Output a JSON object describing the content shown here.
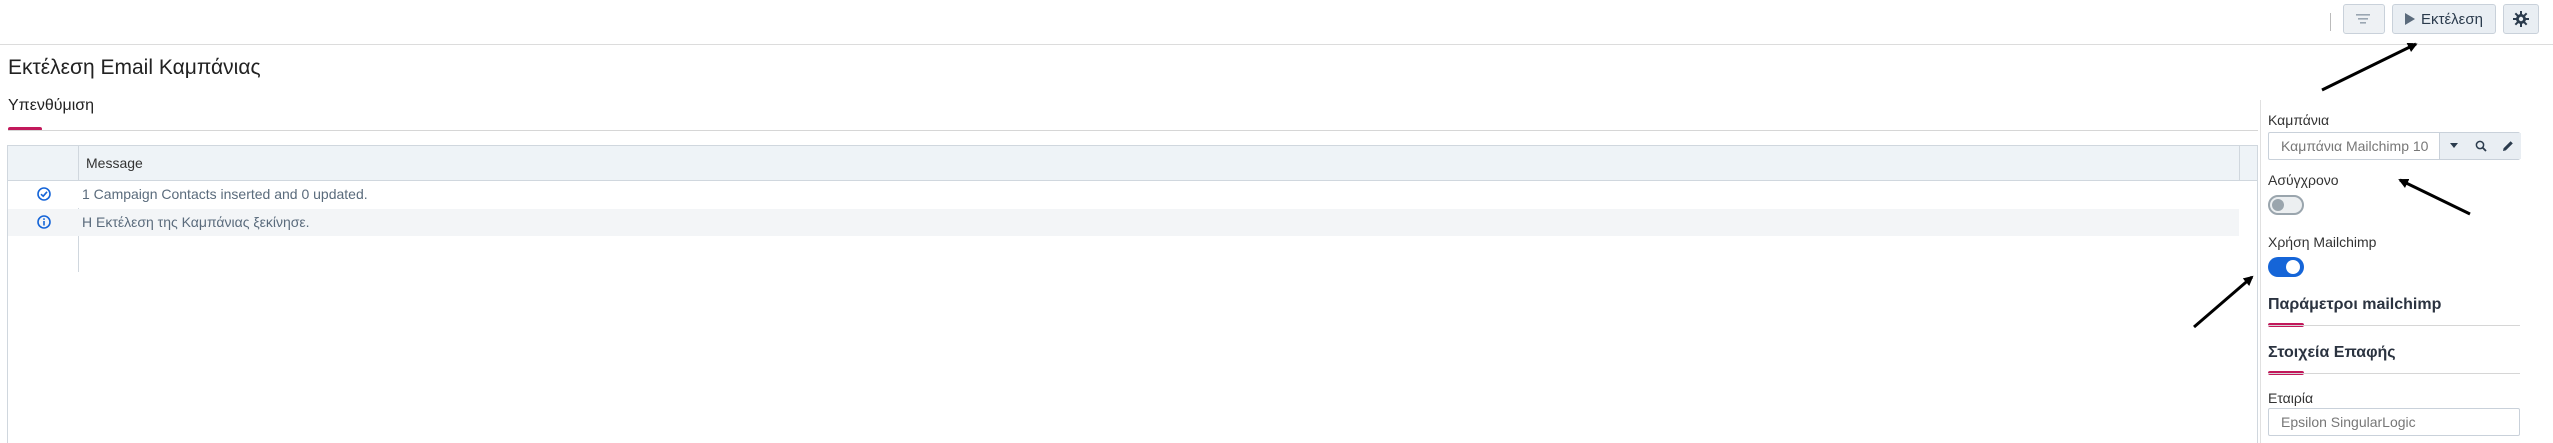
{
  "toolbar": {
    "run_label": "Εκτέλεση"
  },
  "page": {
    "title": "Εκτέλεση Email Καμπάνιας"
  },
  "tab": {
    "label": "Υπενθύμιση"
  },
  "grid": {
    "column_header": "Message",
    "rows": [
      {
        "status": "success",
        "text": "1 Campaign Contacts inserted and 0 updated."
      },
      {
        "status": "info",
        "text": "Η Εκτέλεση της Καμπάνιας ξεκίνησε."
      }
    ]
  },
  "side_panel": {
    "campaign_label": "Καμπάνια",
    "campaign_value": "Καμπάνια Mailchimp 10",
    "async_label": "Ασύγχρονο",
    "async_on": false,
    "mailchimp_label": "Χρήση Mailchimp",
    "mailchimp_on": true,
    "mailchimp_params_title": "Παράμετροι mailchimp",
    "contact_title": "Στοιχεία Επαφής",
    "company_label": "Εταιρία",
    "company_value": "Epsilon SingularLogic"
  },
  "colors": {
    "accent": "#c2185b",
    "toggle_on": "#1565d8",
    "header_bg": "#eef3f7"
  }
}
